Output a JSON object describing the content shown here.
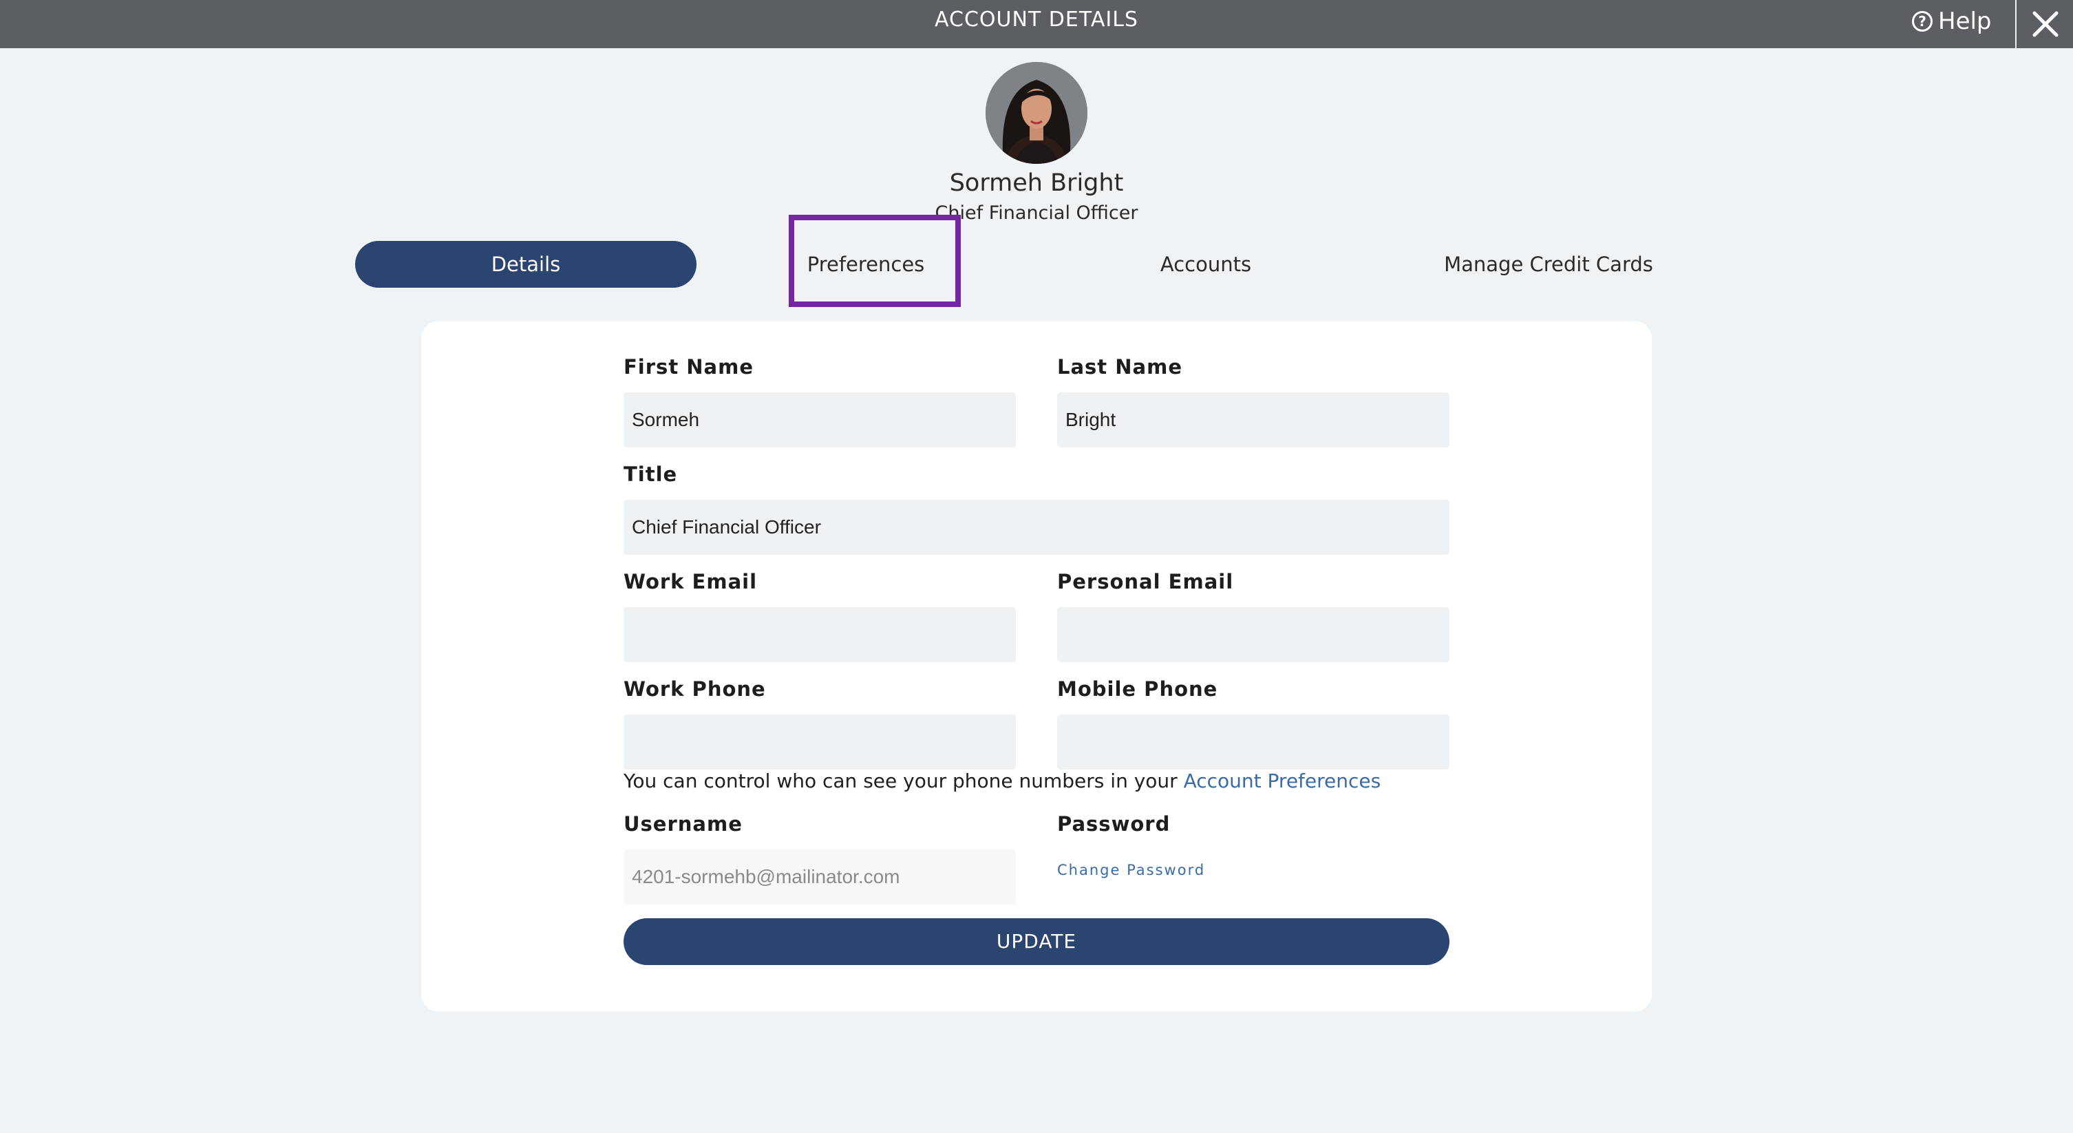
{
  "header": {
    "title": "ACCOUNT DETAILS",
    "help_label": "Help",
    "help_icon": "question-circle-icon",
    "close_icon": "close-icon"
  },
  "profile": {
    "name": "Sormeh Bright",
    "title": "Chief Financial Officer"
  },
  "tabs": [
    {
      "label": "Details",
      "active": true
    },
    {
      "label": "Preferences",
      "active": false
    },
    {
      "label": "Accounts",
      "active": false
    },
    {
      "label": "Manage Credit Cards",
      "active": false
    }
  ],
  "form": {
    "first_name": {
      "label": "First Name",
      "value": "Sormeh"
    },
    "last_name": {
      "label": "Last Name",
      "value": "Bright"
    },
    "title": {
      "label": "Title",
      "value": "Chief Financial Officer"
    },
    "work_email": {
      "label": "Work Email",
      "value": ""
    },
    "personal_email": {
      "label": "Personal Email",
      "value": ""
    },
    "work_phone": {
      "label": "Work Phone",
      "value": ""
    },
    "mobile_phone": {
      "label": "Mobile Phone",
      "value": ""
    },
    "phone_notice": "You can control who can see your phone numbers in your ",
    "phone_notice_link": "Account Preferences",
    "username": {
      "label": "Username",
      "value": "4201-sormehb@mailinator.com"
    },
    "password": {
      "label": "Password",
      "change_label": "Change Password"
    },
    "update_label": "UPDATE"
  },
  "colors": {
    "topbar": "#5b5e63",
    "primary": "#2c4470",
    "link": "#3a6aa7",
    "highlight": "#7326a0",
    "background": "#eff3f6"
  }
}
